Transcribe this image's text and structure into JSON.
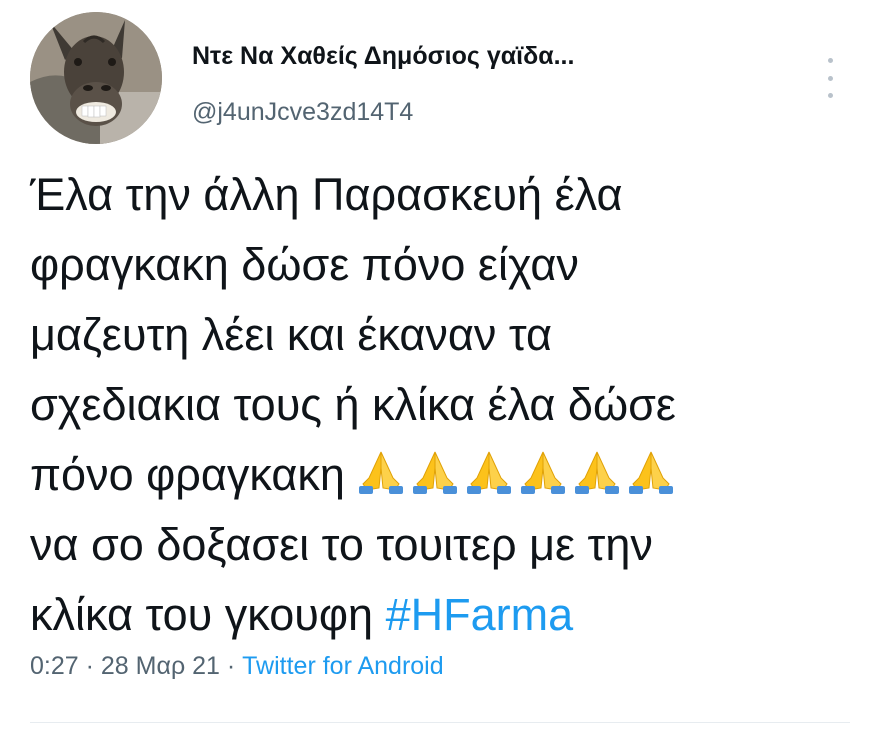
{
  "author": {
    "display_name": "Ντε Να Χαθείς Δημόσιος γαϊδα...",
    "handle": "@j4unJcve3zd14T4",
    "avatar_icon": "donkey-avatar"
  },
  "tweet": {
    "lines": [
      "Έλα την άλλη Παρασκευή έλα",
      "φραγκακη δώσε πόνο είχαν",
      "μαζευτη λέει και έκαναν τα",
      "σχεδιακια τους ή κλίκα έλα δώσε",
      "πόνο φραγκακη",
      "να σο δοξασει το τουιτερ με την",
      "κλίκα του γκουφη"
    ],
    "emoji_name": "folded-hands",
    "emoji_count": 6,
    "hashtag": "#HFarma"
  },
  "meta": {
    "time": "0:27",
    "separator": "·",
    "date": "28 Μαρ 21",
    "source": "Twitter for Android"
  },
  "colors": {
    "link": "#1d9bf0",
    "secondary": "#536471",
    "text": "#0f1419"
  }
}
